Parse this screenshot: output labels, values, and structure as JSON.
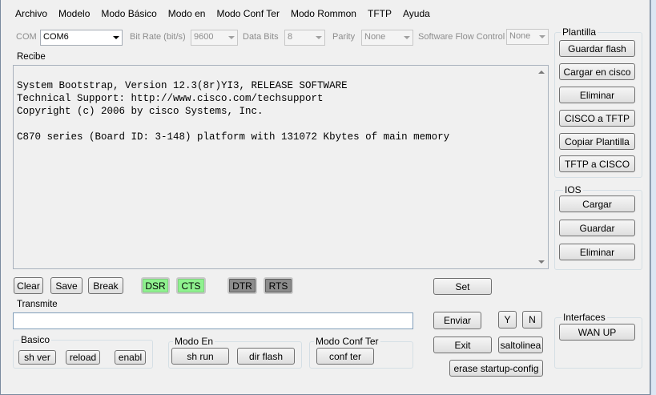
{
  "menu": {
    "items": [
      "Archivo",
      "Modelo",
      "Modo Básico",
      "Modo en",
      "Modo Conf Ter",
      "Modo Rommon",
      "TFTP",
      "Ayuda"
    ]
  },
  "serial": {
    "com_label": "COM",
    "com_value": "COM6",
    "bitrate_label": "Bit Rate (bit/s)",
    "bitrate_value": "9600",
    "databits_label": "Data Bits",
    "databits_value": "8",
    "parity_label": "Parity",
    "parity_value": "None",
    "flow_label": "Software Flow Control",
    "flow_value": "None"
  },
  "recibe": {
    "label": "Recibe",
    "text": "System Bootstrap, Version 12.3(8r)YI3, RELEASE SOFTWARE\nTechnical Support: http://www.cisco.com/techsupport\nCopyright (c) 2006 by cisco Systems, Inc.\n\nC870 series (Board ID: 3-148) platform with 131072 Kbytes of main memory"
  },
  "controls": {
    "clear": "Clear",
    "save": "Save",
    "break": "Break",
    "dsr": "DSR",
    "cts": "CTS",
    "dtr": "DTR",
    "rts": "RTS",
    "set": "Set"
  },
  "transmite": {
    "label": "Transmite",
    "value": ""
  },
  "actions": {
    "enviar": "Enviar",
    "y": "Y",
    "n": "N",
    "exit": "Exit",
    "saltolinea": "saltolinea",
    "erase": "erase startup-config"
  },
  "basico": {
    "title": "Basico",
    "sh_ver": "sh ver",
    "reload": "reload",
    "enabl": "enabl"
  },
  "modo_en": {
    "title": "Modo En",
    "sh_run": "sh run",
    "dir_flash": "dir flash"
  },
  "modo_conf_ter": {
    "title": "Modo Conf Ter",
    "conf_ter": "conf ter"
  },
  "plantilla": {
    "title": "Plantilla",
    "guardar_flash": "Guardar flash",
    "cargar_cisco": "Cargar en cisco",
    "eliminar": "Eliminar",
    "cisco_tftp": "CISCO a TFTP",
    "copiar": "Copiar Plantilla",
    "tftp_cisco": "TFTP a CISCO"
  },
  "ios": {
    "title": "IOS",
    "cargar": "Cargar",
    "guardar": "Guardar",
    "eliminar": "Eliminar"
  },
  "interfaces": {
    "title": "Interfaces",
    "wan_up": "WAN UP"
  },
  "colors": {
    "indicator_on": "#8ff28f",
    "indicator_off": "#8c8c8c",
    "window_bg": "#f0f0f0"
  }
}
